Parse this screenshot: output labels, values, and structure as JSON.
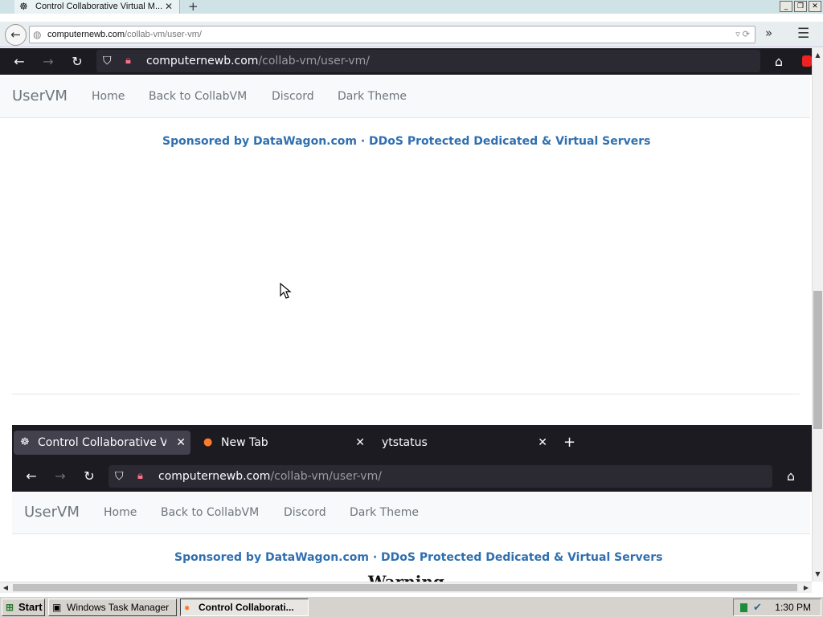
{
  "outer": {
    "tab_title": "Control Collaborative Virtual M...",
    "tab_close": "✕",
    "new_tab": "+",
    "url_host": "computernewb.com",
    "url_path": "/collab-vm/user-vm/",
    "window_buttons": [
      "_",
      "❐",
      "✕"
    ]
  },
  "ff_top": {
    "url_host": "computernewb.com",
    "url_path": "/collab-vm/user-vm/"
  },
  "site_top": {
    "brand": "UserVM",
    "links": [
      "Home",
      "Back to CollabVM",
      "Discord",
      "Dark Theme"
    ],
    "sponsor": "Sponsored by DataWagon.com · DDoS Protected Dedicated & Virtual Servers"
  },
  "ff_bottom": {
    "tabs": [
      {
        "title": "Control Collaborative Virt",
        "icon": "vm-icon"
      },
      {
        "title": "New Tab",
        "icon": "firefox-icon"
      },
      {
        "title": "ytstatus",
        "icon": ""
      }
    ],
    "new_tab": "+",
    "url_host": "computernewb.com",
    "url_path": "/collab-vm/user-vm/"
  },
  "site_bottom": {
    "brand": "UserVM",
    "links": [
      "Home",
      "Back to CollabVM",
      "Discord",
      "Dark Theme"
    ],
    "sponsor": "Sponsored by DataWagon.com · DDoS Protected Dedicated & Virtual Servers",
    "warning_heading": "Warning"
  },
  "taskbar": {
    "start": "Start",
    "items": [
      "Windows Task Manager",
      "Control Collaborati..."
    ],
    "clock": "1:30 PM"
  },
  "colors": {
    "link_blue": "#2f6fb0",
    "ff_dark": "#1c1b22",
    "navbar_text": "#6c757d"
  }
}
